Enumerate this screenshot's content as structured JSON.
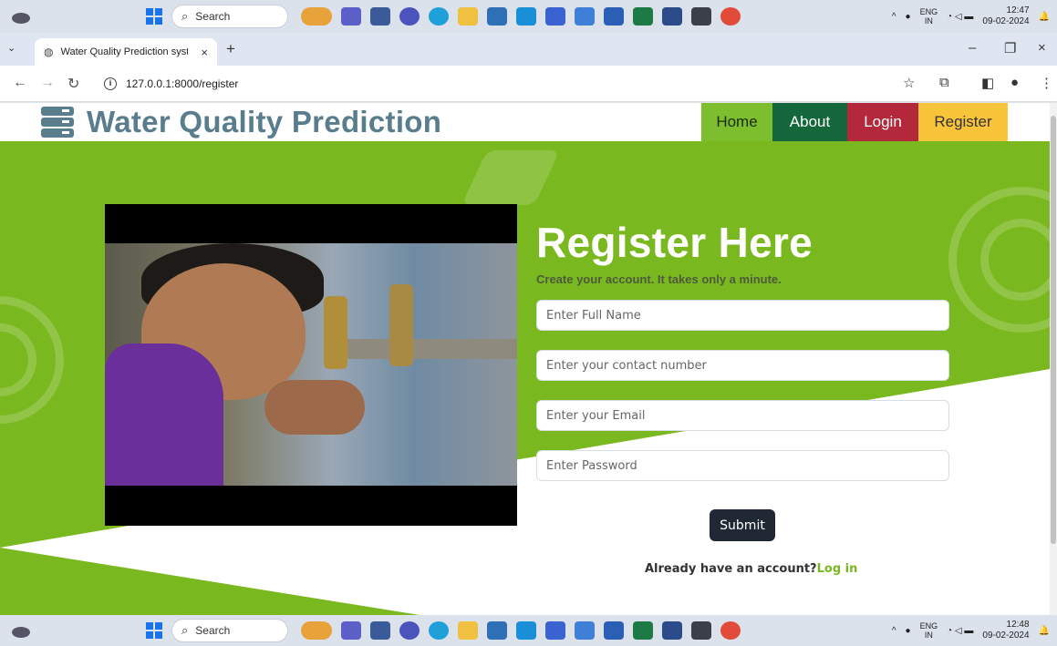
{
  "taskbar": {
    "search_label": "Search",
    "lang_top": "ENG",
    "lang_bottom": "IN",
    "top_time": "12:47",
    "top_date": "09-02-2024",
    "bottom_time": "12:48",
    "bottom_date": "09-02-2024",
    "apps": [
      "widget-icon",
      "teams-icon",
      "files-icon",
      "meet-icon",
      "edge-icon",
      "folder-icon",
      "store-icon",
      "mail-icon",
      "app-icon",
      "app-icon",
      "word-icon",
      "excel-icon",
      "app-icon",
      "terminal-icon",
      "chrome-icon"
    ]
  },
  "browser": {
    "tab_title": "Water Quality Prediction system",
    "url": "127.0.0.1:8000/register"
  },
  "site": {
    "brand": "Water Quality Prediction",
    "nav": {
      "home": "Home",
      "about": "About",
      "login": "Login",
      "register": "Register"
    },
    "colors": {
      "hero_green": "#7ab81f",
      "brand_slate": "#5a7d8e",
      "home_bg": "#7cbe2e",
      "about_bg": "#14673a",
      "login_bg": "#b3283a",
      "register_bg": "#f8c53a"
    }
  },
  "form": {
    "title": "Register Here",
    "subtitle": "Create your account. It takes only a minute.",
    "name_placeholder": "Enter Full Name",
    "contact_placeholder": "Enter your contact number",
    "email_placeholder": "Enter your Email",
    "password_placeholder": "Enter Password",
    "submit_label": "Submit",
    "already_text": "Already have an account?",
    "login_link": "Log in"
  }
}
